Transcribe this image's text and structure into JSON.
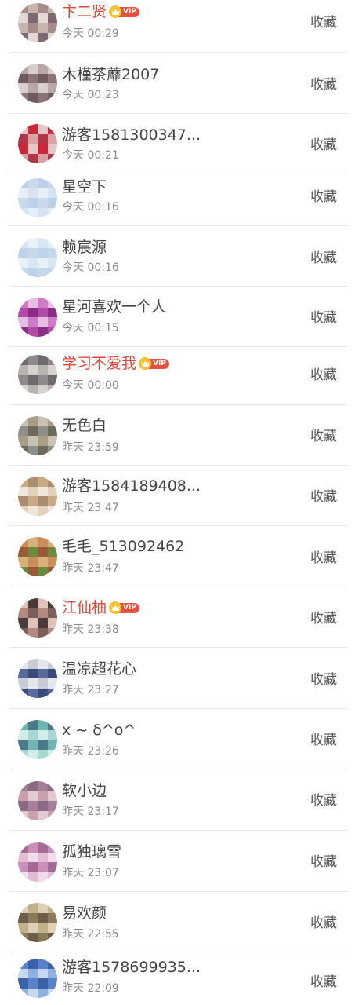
{
  "favorite_label": "收藏",
  "vip_text": "VIP",
  "users": [
    {
      "name": "卞二贤",
      "time": "今天 00:29",
      "vip": true,
      "colors": [
        "#a88c8c",
        "#7e6a74",
        "#c7b5b0",
        "#e2d8d4"
      ]
    },
    {
      "name": "木槿茶蘼2007",
      "time": "今天 00:23",
      "vip": false,
      "colors": [
        "#6f5a60",
        "#b8a7a6",
        "#8a7478",
        "#d7cfcd"
      ]
    },
    {
      "name": "游客1581300347...",
      "time": "今天 00:21",
      "vip": false,
      "colors": [
        "#c8283a",
        "#b03848",
        "#e7c7c5",
        "#d9a3a3"
      ]
    },
    {
      "name": "星空下",
      "time": "今天 00:16",
      "vip": false,
      "colors": [
        "#d6e4f2",
        "#c8d9ec",
        "#e6eef7",
        "#bcd0e8"
      ]
    },
    {
      "name": "赖宸源",
      "time": "今天 00:16",
      "vip": false,
      "colors": [
        "#d8e6f3",
        "#c6d8ec",
        "#e8f0f8",
        "#bed2e9"
      ]
    },
    {
      "name": "星河喜欢一个人",
      "time": "今天 00:15",
      "vip": false,
      "colors": [
        "#b24aa8",
        "#d07bc6",
        "#8a2d86",
        "#e7bde3"
      ]
    },
    {
      "name": "学习不爱我",
      "time": "今天 00:00",
      "vip": true,
      "colors": [
        "#8e8a8c",
        "#b9b3b0",
        "#6e6a6d",
        "#d8d2cf"
      ]
    },
    {
      "name": "无色白",
      "time": "昨天 23:59",
      "vip": false,
      "colors": [
        "#6d6a5a",
        "#a89e86",
        "#8d8f8a",
        "#c9c2b2"
      ]
    },
    {
      "name": "游客1584189408...",
      "time": "昨天 23:47",
      "vip": false,
      "colors": [
        "#c9aa86",
        "#e3d1bb",
        "#a98e72",
        "#f0e6da"
      ]
    },
    {
      "name": "毛毛_513092462",
      "time": "昨天 23:47",
      "vip": false,
      "colors": [
        "#9a5a3a",
        "#c98e5c",
        "#6a8a3c",
        "#d8b07a"
      ]
    },
    {
      "name": "江仙柚",
      "time": "昨天 23:38",
      "vip": true,
      "colors": [
        "#4a3a3a",
        "#b28a80",
        "#e0c2b8",
        "#7a5e58"
      ]
    },
    {
      "name": "温凉超花心",
      "time": "昨天 23:27",
      "vip": false,
      "colors": [
        "#3a4a7a",
        "#c8ccd6",
        "#5a6a9a",
        "#e4e6ec"
      ]
    },
    {
      "name": "x ~ δ^o^",
      "time": "昨天 23:26",
      "vip": false,
      "colors": [
        "#6fb6b0",
        "#a9d8d2",
        "#4a7a8a",
        "#d2ecea"
      ]
    },
    {
      "name": "软小边",
      "time": "昨天 23:17",
      "vip": false,
      "colors": [
        "#c8a0b0",
        "#a37f98",
        "#e2c8d2",
        "#8a6a82"
      ]
    },
    {
      "name": "孤独璃雪",
      "time": "昨天 23:07",
      "vip": false,
      "colors": [
        "#c98fb8",
        "#e3bcd6",
        "#a56a94",
        "#f0dcea"
      ]
    },
    {
      "name": "易欢颜",
      "time": "昨天 22:55",
      "vip": false,
      "colors": [
        "#8a7a5a",
        "#c2b08a",
        "#6a5e48",
        "#ddd0b4"
      ]
    },
    {
      "name": "游客1578699935...",
      "time": "昨天 22:09",
      "vip": false,
      "colors": [
        "#5a82c8",
        "#8fb0e0",
        "#3a62a8",
        "#c6d8f2"
      ]
    }
  ]
}
